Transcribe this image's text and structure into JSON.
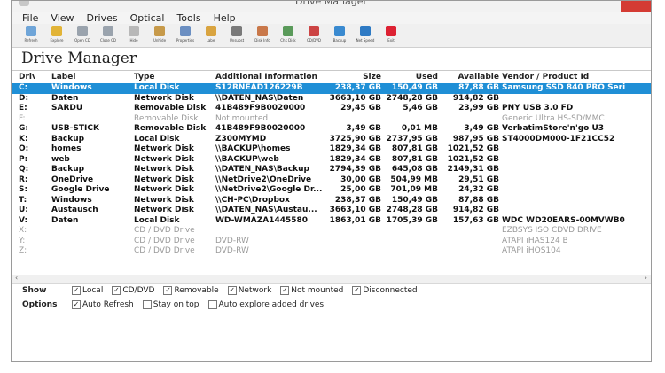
{
  "window": {
    "title": "Drive Manager"
  },
  "menu": [
    "File",
    "View",
    "Drives",
    "Optical",
    "Tools",
    "Help"
  ],
  "toolbar": [
    {
      "label": "Refresh",
      "color": "#6fa5d8"
    },
    {
      "label": "Explore",
      "color": "#e2b437"
    },
    {
      "label": "Open CD",
      "color": "#9aa3ad"
    },
    {
      "label": "Close CD",
      "color": "#9aa3ad"
    },
    {
      "label": "Hide",
      "color": "#b8b8b8"
    },
    {
      "label": "Unhide",
      "color": "#c79a4a"
    },
    {
      "label": "Properties",
      "color": "#6b8fc2"
    },
    {
      "label": "Label",
      "color": "#d9a440"
    },
    {
      "label": "Unsubst",
      "color": "#7a7a7a"
    },
    {
      "label": "Disk Info",
      "color": "#c9784a"
    },
    {
      "label": "Chk Disk",
      "color": "#5a9a5a"
    },
    {
      "label": "CD/DVD",
      "color": "#c44"
    },
    {
      "label": "Backup",
      "color": "#3a8ad0"
    },
    {
      "label": "Net Speed",
      "color": "#2e7ac4"
    },
    {
      "label": "Exit",
      "color": "#d23"
    }
  ],
  "heading": "Drive Manager",
  "columns": {
    "drive": "Drive",
    "label": "Label",
    "type": "Type",
    "info": "Additional Information",
    "size": "Size",
    "used": "Used",
    "available": "Available",
    "vendor": "Vendor / Product Id"
  },
  "drives": [
    {
      "drive": "C:",
      "label": "Windows",
      "type": "Local Disk",
      "info": "S12RNEAD126229B",
      "size": "238,37 GB",
      "used": "150,49 GB",
      "available": "87,88 GB",
      "vendor": "Samsung SSD 840 PRO Seri",
      "state": "selected"
    },
    {
      "drive": "D:",
      "label": "Daten",
      "type": "Network Disk",
      "info": "\\\\DATEN_NAS\\Daten",
      "size": "3663,10 GB",
      "used": "2748,28 GB",
      "available": "914,82 GB",
      "vendor": "",
      "state": "normal"
    },
    {
      "drive": "E:",
      "label": "SARDU",
      "type": "Removable Disk",
      "info": "41B489F9B0020000",
      "size": "29,45 GB",
      "used": "5,46 GB",
      "available": "23,99 GB",
      "vendor": "PNY    USB 3.0 FD",
      "state": "normal"
    },
    {
      "drive": "F:",
      "label": "",
      "type": "Removable Disk",
      "info": "Not mounted",
      "size": "",
      "used": "",
      "available": "",
      "vendor": "Generic Ultra HS-SD/MMC",
      "state": "dim"
    },
    {
      "drive": "G:",
      "label": "USB-STICK",
      "type": "Removable Disk",
      "info": "41B489F9B0020000",
      "size": "3,49 GB",
      "used": "0,01 MB",
      "available": "3,49 GB",
      "vendor": "VerbatimStore'n'go U3",
      "state": "normal"
    },
    {
      "drive": "K:",
      "label": "Backup",
      "type": "Local Disk",
      "info": "Z300MYMD",
      "size": "3725,90 GB",
      "used": "2737,95 GB",
      "available": "987,95 GB",
      "vendor": "ST4000DM000-1F21CC52",
      "state": "normal"
    },
    {
      "drive": "O:",
      "label": "homes",
      "type": "Network Disk",
      "info": "\\\\BACKUP\\homes",
      "size": "1829,34 GB",
      "used": "807,81 GB",
      "available": "1021,52 GB",
      "vendor": "",
      "state": "normal"
    },
    {
      "drive": "P:",
      "label": "web",
      "type": "Network Disk",
      "info": "\\\\BACKUP\\web",
      "size": "1829,34 GB",
      "used": "807,81 GB",
      "available": "1021,52 GB",
      "vendor": "",
      "state": "normal"
    },
    {
      "drive": "Q:",
      "label": "Backup",
      "type": "Network Disk",
      "info": "\\\\DATEN_NAS\\Backup",
      "size": "2794,39 GB",
      "used": "645,08 GB",
      "available": "2149,31 GB",
      "vendor": "",
      "state": "normal"
    },
    {
      "drive": "R:",
      "label": "OneDrive",
      "type": "Network Disk",
      "info": "\\\\NetDrive2\\OneDrive",
      "size": "30,00 GB",
      "used": "504,99 MB",
      "available": "29,51 GB",
      "vendor": "",
      "state": "normal"
    },
    {
      "drive": "S:",
      "label": "Google Drive",
      "type": "Network Disk",
      "info": "\\\\NetDrive2\\Google Dr...",
      "size": "25,00 GB",
      "used": "701,09 MB",
      "available": "24,32 GB",
      "vendor": "",
      "state": "normal"
    },
    {
      "drive": "T:",
      "label": "Windows",
      "type": "Network Disk",
      "info": "\\\\CH-PC\\Dropbox",
      "size": "238,37 GB",
      "used": "150,49 GB",
      "available": "87,88 GB",
      "vendor": "",
      "state": "normal"
    },
    {
      "drive": "U:",
      "label": "Austausch",
      "type": "Network Disk",
      "info": "\\\\DATEN_NAS\\Austau...",
      "size": "3663,10 GB",
      "used": "2748,28 GB",
      "available": "914,82 GB",
      "vendor": "",
      "state": "normal"
    },
    {
      "drive": "V:",
      "label": "Daten",
      "type": "Local Disk",
      "info": "WD-WMAZA1445580",
      "size": "1863,01 GB",
      "used": "1705,39 GB",
      "available": "157,63 GB",
      "vendor": "WDC    WD20EARS-00MVWB0",
      "state": "normal"
    },
    {
      "drive": "X:",
      "label": "",
      "type": "CD / DVD Drive",
      "info": "",
      "size": "",
      "used": "",
      "available": "",
      "vendor": "EZBSYS  ISO CDVD DRIVE",
      "state": "dim"
    },
    {
      "drive": "Y:",
      "label": "",
      "type": "CD / DVD Drive",
      "info": "DVD-RW",
      "size": "",
      "used": "",
      "available": "",
      "vendor": "ATAPI  iHAS124  B",
      "state": "dim"
    },
    {
      "drive": "Z:",
      "label": "",
      "type": "CD / DVD Drive",
      "info": "DVD-RW",
      "size": "",
      "used": "",
      "available": "",
      "vendor": "ATAPI  iHOS104",
      "state": "dim"
    }
  ],
  "show": {
    "title": "Show",
    "items": [
      {
        "label": "Local",
        "checked": true
      },
      {
        "label": "CD/DVD",
        "checked": true
      },
      {
        "label": "Removable",
        "checked": true
      },
      {
        "label": "Network",
        "checked": true
      },
      {
        "label": "Not mounted",
        "checked": true
      },
      {
        "label": "Disconnected",
        "checked": true
      }
    ]
  },
  "options": {
    "title": "Options",
    "items": [
      {
        "label": "Auto Refresh",
        "checked": true
      },
      {
        "label": "Stay on top",
        "checked": false
      },
      {
        "label": "Auto explore added drives",
        "checked": false
      }
    ]
  },
  "colors": {
    "selection": "#1f8fd6",
    "close": "#d43b33",
    "dim_text": "#9a9a9a"
  }
}
